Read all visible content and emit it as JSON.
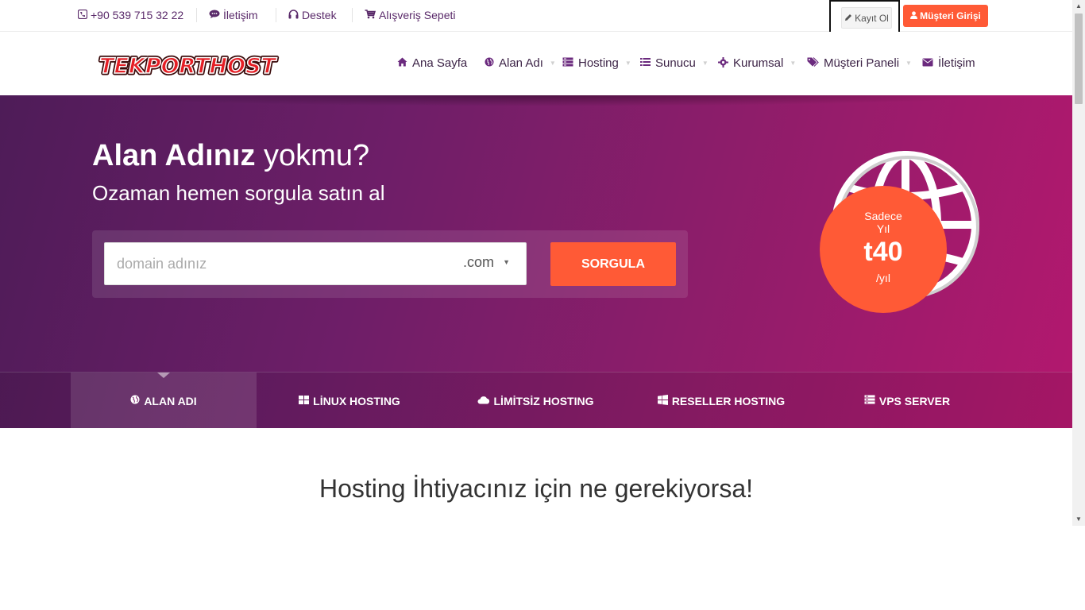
{
  "topbar": {
    "phone": "+90 539 715 32 22",
    "contact": "İletişim",
    "support": "Destek",
    "cart": "Alışveriş Sepeti",
    "register": "Kayıt Ol",
    "login": "Müşteri Girişi"
  },
  "header": {
    "logo_text": "TEKPORTHOST",
    "nav": [
      {
        "label": "Ana Sayfa",
        "icon": "home-icon"
      },
      {
        "label": "Alan Adı",
        "icon": "globe-icon"
      },
      {
        "label": "Hosting",
        "icon": "server-icon"
      },
      {
        "label": "Sunucu",
        "icon": "list-icon"
      },
      {
        "label": "Kurumsal",
        "icon": "gear-icon"
      },
      {
        "label": "Müşteri Paneli",
        "icon": "tags-icon"
      },
      {
        "label": "İletişim",
        "icon": "envelope-icon"
      }
    ]
  },
  "hero": {
    "title_bold": "Alan Adınız",
    "title_light": " yokmu?",
    "subtitle": "Ozaman hemen sorgula satın al",
    "search_placeholder": "domain adınız",
    "tld": ".com",
    "search_button": "SORGULA",
    "badge_line1": "Sadece",
    "badge_line2": "Yıl",
    "badge_price": "t40",
    "badge_per": "/yıl"
  },
  "tabs": [
    {
      "label": "ALAN ADI",
      "icon": "globe-icon",
      "active": true
    },
    {
      "label": "LİNUX HOSTING",
      "icon": "grid-icon",
      "active": false
    },
    {
      "label": "LİMİTSİZ HOSTING",
      "icon": "cloud-icon",
      "active": false
    },
    {
      "label": "RESELLER HOSTING",
      "icon": "windows-icon",
      "active": false
    },
    {
      "label": "VPS SERVER",
      "icon": "server-icon",
      "active": false
    }
  ],
  "section": {
    "title": "Hosting İhtiyacınız için ne gerekiyorsa!"
  },
  "colors": {
    "accent": "#ff5a36",
    "hero_start": "#4e1c58",
    "hero_end": "#b3186e",
    "nav_text": "#3d2447"
  }
}
